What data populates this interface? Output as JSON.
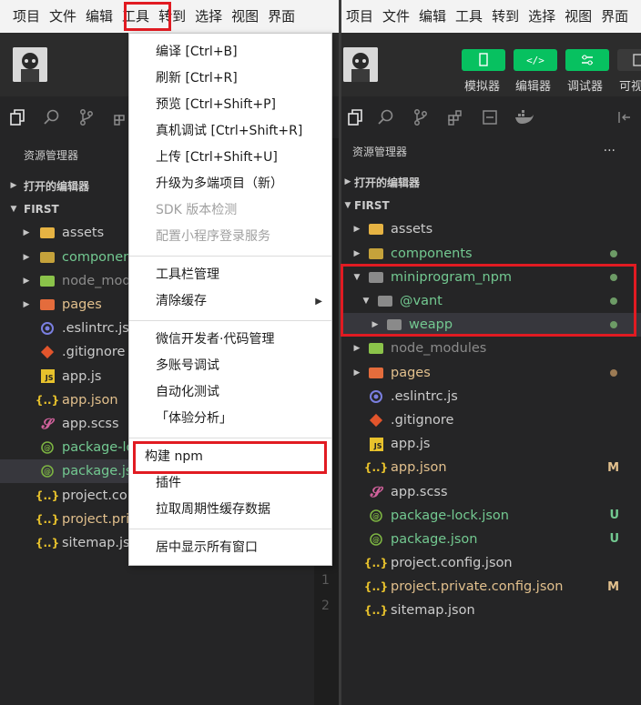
{
  "left": {
    "menu": [
      "项目",
      "文件",
      "编辑",
      "工具",
      "转到",
      "选择",
      "视图",
      "界面"
    ],
    "explorer_title": "资源管理器",
    "open_editors": "打开的编辑器",
    "root": "FIRST",
    "items": [
      {
        "label": "assets"
      },
      {
        "label": "componen"
      },
      {
        "label": "node_mod"
      },
      {
        "label": "pages"
      },
      {
        "label": ".eslintrc.js"
      },
      {
        "label": ".gitignore"
      },
      {
        "label": "app.js"
      },
      {
        "label": "app.json"
      },
      {
        "label": "app.scss"
      },
      {
        "label": "package-lo"
      },
      {
        "label": "package.js"
      },
      {
        "label": "project.co"
      },
      {
        "label": "project.pri"
      },
      {
        "label": "sitemap.jso"
      }
    ],
    "editor_gutter": [
      "1",
      "2"
    ]
  },
  "dropdown": {
    "items": [
      {
        "label": "编译  [Ctrl+B]"
      },
      {
        "label": "刷新  [Ctrl+R]"
      },
      {
        "label": "预览  [Ctrl+Shift+P]"
      },
      {
        "label": "真机调试  [Ctrl+Shift+R]"
      },
      {
        "label": "上传  [Ctrl+Shift+U]"
      },
      {
        "label": "升级为多端项目（新）"
      },
      {
        "label": "SDK 版本检测"
      },
      {
        "label": "配置小程序登录服务"
      },
      {
        "label": "工具栏管理"
      },
      {
        "label": "清除缓存"
      },
      {
        "label": "微信开发者·代码管理"
      },
      {
        "label": "多账号调试"
      },
      {
        "label": "自动化测试"
      },
      {
        "label": "「体验分析」"
      },
      {
        "label": "构建 npm"
      },
      {
        "label": "插件"
      },
      {
        "label": "拉取周期性缓存数据"
      },
      {
        "label": "居中显示所有窗口"
      }
    ],
    "submenu_arrow": "▶"
  },
  "right": {
    "menu": [
      "项目",
      "文件",
      "编辑",
      "工具",
      "转到",
      "选择",
      "视图",
      "界面"
    ],
    "toolbar": [
      "模拟器",
      "编辑器",
      "调试器",
      "可视"
    ],
    "explorer_title": "资源管理器",
    "more": "···",
    "open_editors": "打开的编辑器",
    "root": "FIRST",
    "items": [
      {
        "label": "assets"
      },
      {
        "label": "components"
      },
      {
        "label": "miniprogram_npm"
      },
      {
        "label": "@vant"
      },
      {
        "label": "weapp"
      },
      {
        "label": "node_modules"
      },
      {
        "label": "pages"
      },
      {
        "label": ".eslintrc.js"
      },
      {
        "label": ".gitignore"
      },
      {
        "label": "app.js"
      },
      {
        "label": "app.json",
        "badge": "M"
      },
      {
        "label": "app.scss"
      },
      {
        "label": "package-lock.json",
        "badge": "U"
      },
      {
        "label": "package.json",
        "badge": "U"
      },
      {
        "label": "project.config.json"
      },
      {
        "label": "project.private.config.json",
        "badge": "M"
      },
      {
        "label": "sitemap.json"
      }
    ]
  },
  "colors": {
    "highlight": "#e11b22",
    "wechat_green": "#07c160",
    "git_added": "#73c991"
  }
}
